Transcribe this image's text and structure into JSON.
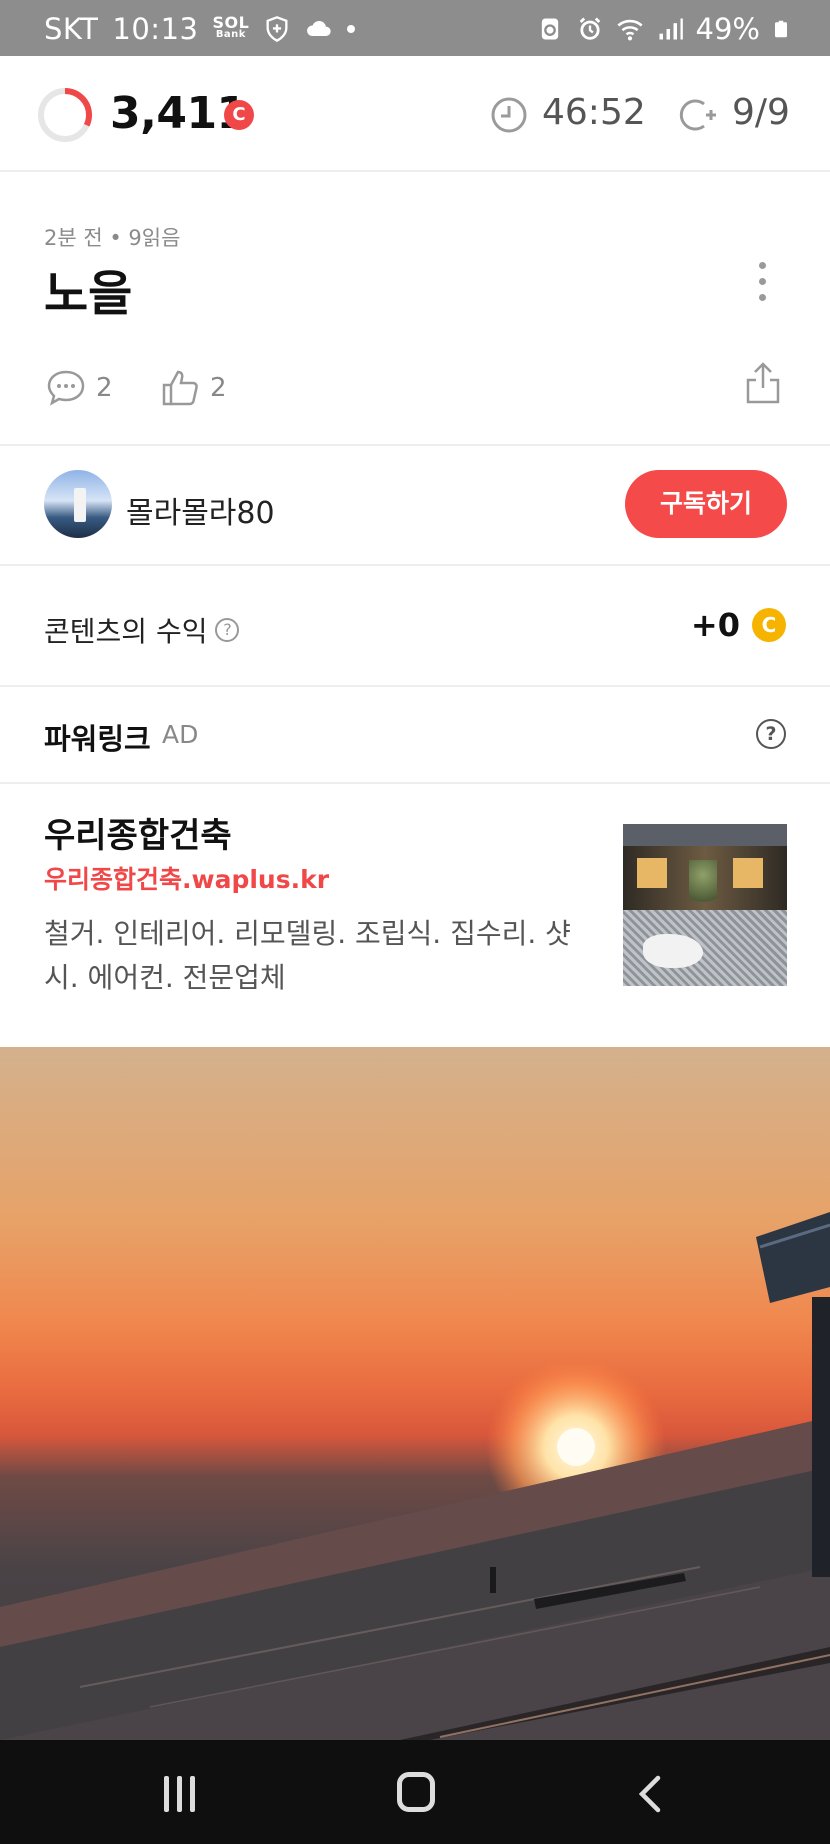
{
  "status_bar": {
    "carrier": "SKT",
    "time": "10:13",
    "bank_label_top": "SOL",
    "bank_label_bottom": "Bank",
    "battery": "49%"
  },
  "points_bar": {
    "points": "3,411",
    "points_badge": "C",
    "timer": "46:52",
    "count": "9/9",
    "ring_progress": 0.32
  },
  "post": {
    "meta": "2분 전 • 9읽음",
    "title": "노을",
    "comments": "2",
    "likes": "2"
  },
  "author": {
    "name": "몰라몰라80",
    "subscribe_label": "구독하기"
  },
  "earnings": {
    "label": "콘텐츠의 수익",
    "help": "?",
    "value": "+0",
    "badge": "C"
  },
  "powerlink": {
    "title": "파워링크",
    "ad_label": "AD",
    "help": "?",
    "ad": {
      "name": "우리종합건축",
      "url": "우리종합건축.waplus.kr",
      "description": "철거. 인테리어. 리모델링. 조립식. 집수리. 샷시. 에어컨. 전문업체"
    }
  },
  "colors": {
    "accent": "#f44a4a",
    "coin": "#f6b400",
    "navbar": "#0f0f0f",
    "statusbar": "#8d8d8d"
  }
}
